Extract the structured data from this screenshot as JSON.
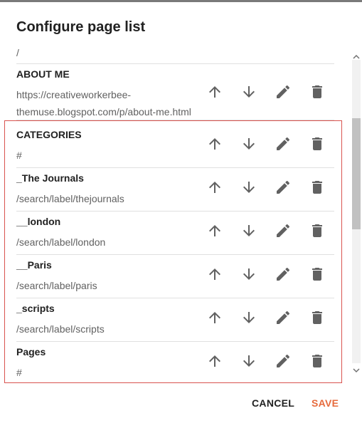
{
  "dialog": {
    "title": "Configure page list",
    "cancel_label": "CANCEL",
    "save_label": "SAVE"
  },
  "partial_row": {
    "url": "/"
  },
  "pages": [
    {
      "name": "ABOUT ME",
      "url_line1": "https://creativeworkerbee-",
      "url_line2": "themuse.blogspot.com/p/about-me.html"
    },
    {
      "name": "CATEGORIES",
      "url_line1": "#"
    },
    {
      "name": "_The Journals",
      "url_line1": "/search/label/thejournals"
    },
    {
      "name": "__london",
      "url_line1": "/search/label/london"
    },
    {
      "name": "__Paris",
      "url_line1": "/search/label/paris"
    },
    {
      "name": "_scripts",
      "url_line1": "/search/label/scripts"
    },
    {
      "name": "Pages",
      "url_line1": "#"
    }
  ],
  "icons": {
    "move_up": "arrow-up-icon",
    "move_down": "arrow-down-icon",
    "edit": "pencil-icon",
    "delete": "trash-icon"
  },
  "colors": {
    "accent": "#e66a3c",
    "highlight_border": "#d9534f",
    "icon": "#616161"
  }
}
